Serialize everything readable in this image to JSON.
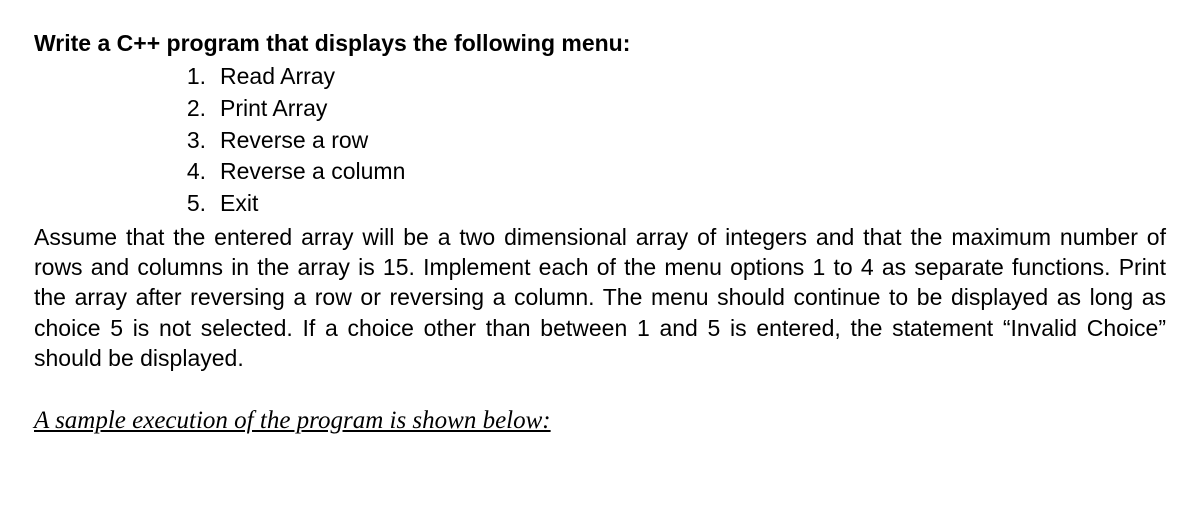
{
  "heading": "Write a C++ program that displays the following menu:",
  "menu": [
    {
      "num": "1.",
      "label": "Read Array"
    },
    {
      "num": "2.",
      "label": "Print Array"
    },
    {
      "num": "3.",
      "label": "Reverse a row"
    },
    {
      "num": "4.",
      "label": "Reverse a column"
    },
    {
      "num": "5.",
      "label": "Exit"
    }
  ],
  "paragraph": "Assume that the entered array will be a two dimensional array of integers and that the maximum number of rows and columns in the array is 15. Implement each of the menu options 1 to 4 as separate functions. Print the array after reversing a row or reversing a column.  The menu should continue to be displayed as long as choice 5 is not selected. If a choice other than between 1 and 5 is entered, the statement “Invalid Choice” should be displayed.",
  "sample_label": "A sample execution of the program is shown below:"
}
